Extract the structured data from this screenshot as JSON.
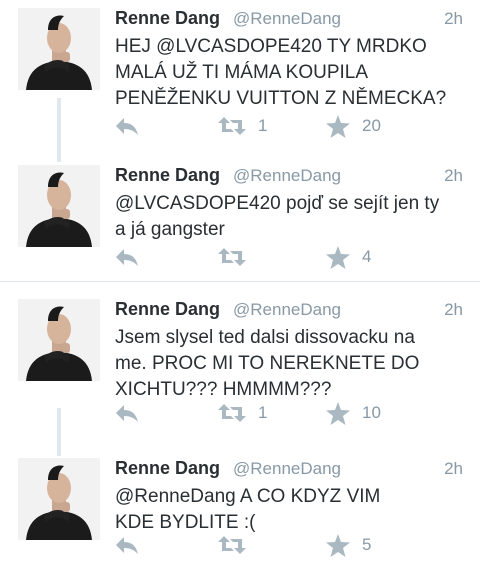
{
  "tweets": [
    {
      "name": "Renne Dang",
      "handle": "@RenneDang",
      "time": "2h",
      "text": "HEJ @LVCASDOPE420 TY MRDKO\nMALÁ UŽ TI MÁMA KOUPILA\nPENĚŽENKU VUITTON Z NĚMECKA?",
      "retweets": "1",
      "favorites": "20"
    },
    {
      "name": "Renne Dang",
      "handle": "@RenneDang",
      "time": "2h",
      "text": "@LVCASDOPE420 pojď se sejít jen ty\na já gangster",
      "retweets": "",
      "favorites": "4"
    },
    {
      "name": "Renne Dang",
      "handle": "@RenneDang",
      "time": "2h",
      "text": "Jsem slysel ted dalsi dissovacku na\nme. PROC MI TO NEREKNETE DO\nXICHTU??? HMMMM???",
      "retweets": "1",
      "favorites": "10"
    },
    {
      "name": "Renne Dang",
      "handle": "@RenneDang",
      "time": "2h",
      "text": "@RenneDang A CO KDYZ VIM\nKDE BYDLITE :(",
      "retweets": "",
      "favorites": "5"
    }
  ],
  "icons": {
    "reply": "reply-icon",
    "retweet": "retweet-icon",
    "favorite": "star-icon"
  },
  "colors": {
    "name": "#292f33",
    "meta": "#8899a6",
    "icon": "#aab8c2",
    "thread": "#e1e8ed"
  }
}
